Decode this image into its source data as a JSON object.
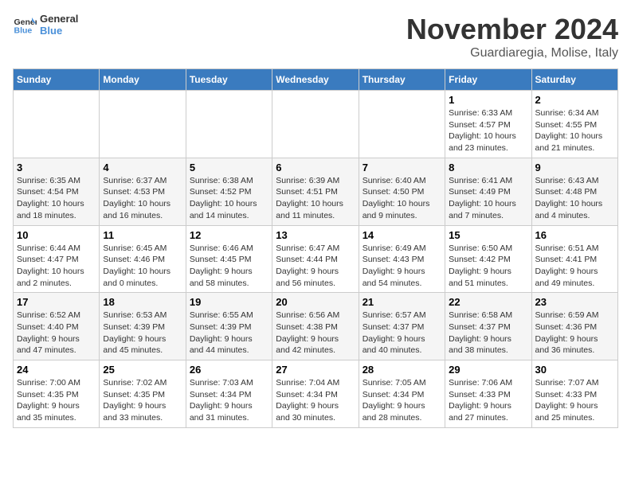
{
  "logo": {
    "line1": "General",
    "line2": "Blue"
  },
  "calendar": {
    "title": "November 2024",
    "subtitle": "Guardiaregia, Molise, Italy"
  },
  "headers": [
    "Sunday",
    "Monday",
    "Tuesday",
    "Wednesday",
    "Thursday",
    "Friday",
    "Saturday"
  ],
  "weeks": [
    [
      {
        "day": "",
        "info": ""
      },
      {
        "day": "",
        "info": ""
      },
      {
        "day": "",
        "info": ""
      },
      {
        "day": "",
        "info": ""
      },
      {
        "day": "",
        "info": ""
      },
      {
        "day": "1",
        "info": "Sunrise: 6:33 AM\nSunset: 4:57 PM\nDaylight: 10 hours\nand 23 minutes."
      },
      {
        "day": "2",
        "info": "Sunrise: 6:34 AM\nSunset: 4:55 PM\nDaylight: 10 hours\nand 21 minutes."
      }
    ],
    [
      {
        "day": "3",
        "info": "Sunrise: 6:35 AM\nSunset: 4:54 PM\nDaylight: 10 hours\nand 18 minutes."
      },
      {
        "day": "4",
        "info": "Sunrise: 6:37 AM\nSunset: 4:53 PM\nDaylight: 10 hours\nand 16 minutes."
      },
      {
        "day": "5",
        "info": "Sunrise: 6:38 AM\nSunset: 4:52 PM\nDaylight: 10 hours\nand 14 minutes."
      },
      {
        "day": "6",
        "info": "Sunrise: 6:39 AM\nSunset: 4:51 PM\nDaylight: 10 hours\nand 11 minutes."
      },
      {
        "day": "7",
        "info": "Sunrise: 6:40 AM\nSunset: 4:50 PM\nDaylight: 10 hours\nand 9 minutes."
      },
      {
        "day": "8",
        "info": "Sunrise: 6:41 AM\nSunset: 4:49 PM\nDaylight: 10 hours\nand 7 minutes."
      },
      {
        "day": "9",
        "info": "Sunrise: 6:43 AM\nSunset: 4:48 PM\nDaylight: 10 hours\nand 4 minutes."
      }
    ],
    [
      {
        "day": "10",
        "info": "Sunrise: 6:44 AM\nSunset: 4:47 PM\nDaylight: 10 hours\nand 2 minutes."
      },
      {
        "day": "11",
        "info": "Sunrise: 6:45 AM\nSunset: 4:46 PM\nDaylight: 10 hours\nand 0 minutes."
      },
      {
        "day": "12",
        "info": "Sunrise: 6:46 AM\nSunset: 4:45 PM\nDaylight: 9 hours\nand 58 minutes."
      },
      {
        "day": "13",
        "info": "Sunrise: 6:47 AM\nSunset: 4:44 PM\nDaylight: 9 hours\nand 56 minutes."
      },
      {
        "day": "14",
        "info": "Sunrise: 6:49 AM\nSunset: 4:43 PM\nDaylight: 9 hours\nand 54 minutes."
      },
      {
        "day": "15",
        "info": "Sunrise: 6:50 AM\nSunset: 4:42 PM\nDaylight: 9 hours\nand 51 minutes."
      },
      {
        "day": "16",
        "info": "Sunrise: 6:51 AM\nSunset: 4:41 PM\nDaylight: 9 hours\nand 49 minutes."
      }
    ],
    [
      {
        "day": "17",
        "info": "Sunrise: 6:52 AM\nSunset: 4:40 PM\nDaylight: 9 hours\nand 47 minutes."
      },
      {
        "day": "18",
        "info": "Sunrise: 6:53 AM\nSunset: 4:39 PM\nDaylight: 9 hours\nand 45 minutes."
      },
      {
        "day": "19",
        "info": "Sunrise: 6:55 AM\nSunset: 4:39 PM\nDaylight: 9 hours\nand 44 minutes."
      },
      {
        "day": "20",
        "info": "Sunrise: 6:56 AM\nSunset: 4:38 PM\nDaylight: 9 hours\nand 42 minutes."
      },
      {
        "day": "21",
        "info": "Sunrise: 6:57 AM\nSunset: 4:37 PM\nDaylight: 9 hours\nand 40 minutes."
      },
      {
        "day": "22",
        "info": "Sunrise: 6:58 AM\nSunset: 4:37 PM\nDaylight: 9 hours\nand 38 minutes."
      },
      {
        "day": "23",
        "info": "Sunrise: 6:59 AM\nSunset: 4:36 PM\nDaylight: 9 hours\nand 36 minutes."
      }
    ],
    [
      {
        "day": "24",
        "info": "Sunrise: 7:00 AM\nSunset: 4:35 PM\nDaylight: 9 hours\nand 35 minutes."
      },
      {
        "day": "25",
        "info": "Sunrise: 7:02 AM\nSunset: 4:35 PM\nDaylight: 9 hours\nand 33 minutes."
      },
      {
        "day": "26",
        "info": "Sunrise: 7:03 AM\nSunset: 4:34 PM\nDaylight: 9 hours\nand 31 minutes."
      },
      {
        "day": "27",
        "info": "Sunrise: 7:04 AM\nSunset: 4:34 PM\nDaylight: 9 hours\nand 30 minutes."
      },
      {
        "day": "28",
        "info": "Sunrise: 7:05 AM\nSunset: 4:34 PM\nDaylight: 9 hours\nand 28 minutes."
      },
      {
        "day": "29",
        "info": "Sunrise: 7:06 AM\nSunset: 4:33 PM\nDaylight: 9 hours\nand 27 minutes."
      },
      {
        "day": "30",
        "info": "Sunrise: 7:07 AM\nSunset: 4:33 PM\nDaylight: 9 hours\nand 25 minutes."
      }
    ]
  ]
}
